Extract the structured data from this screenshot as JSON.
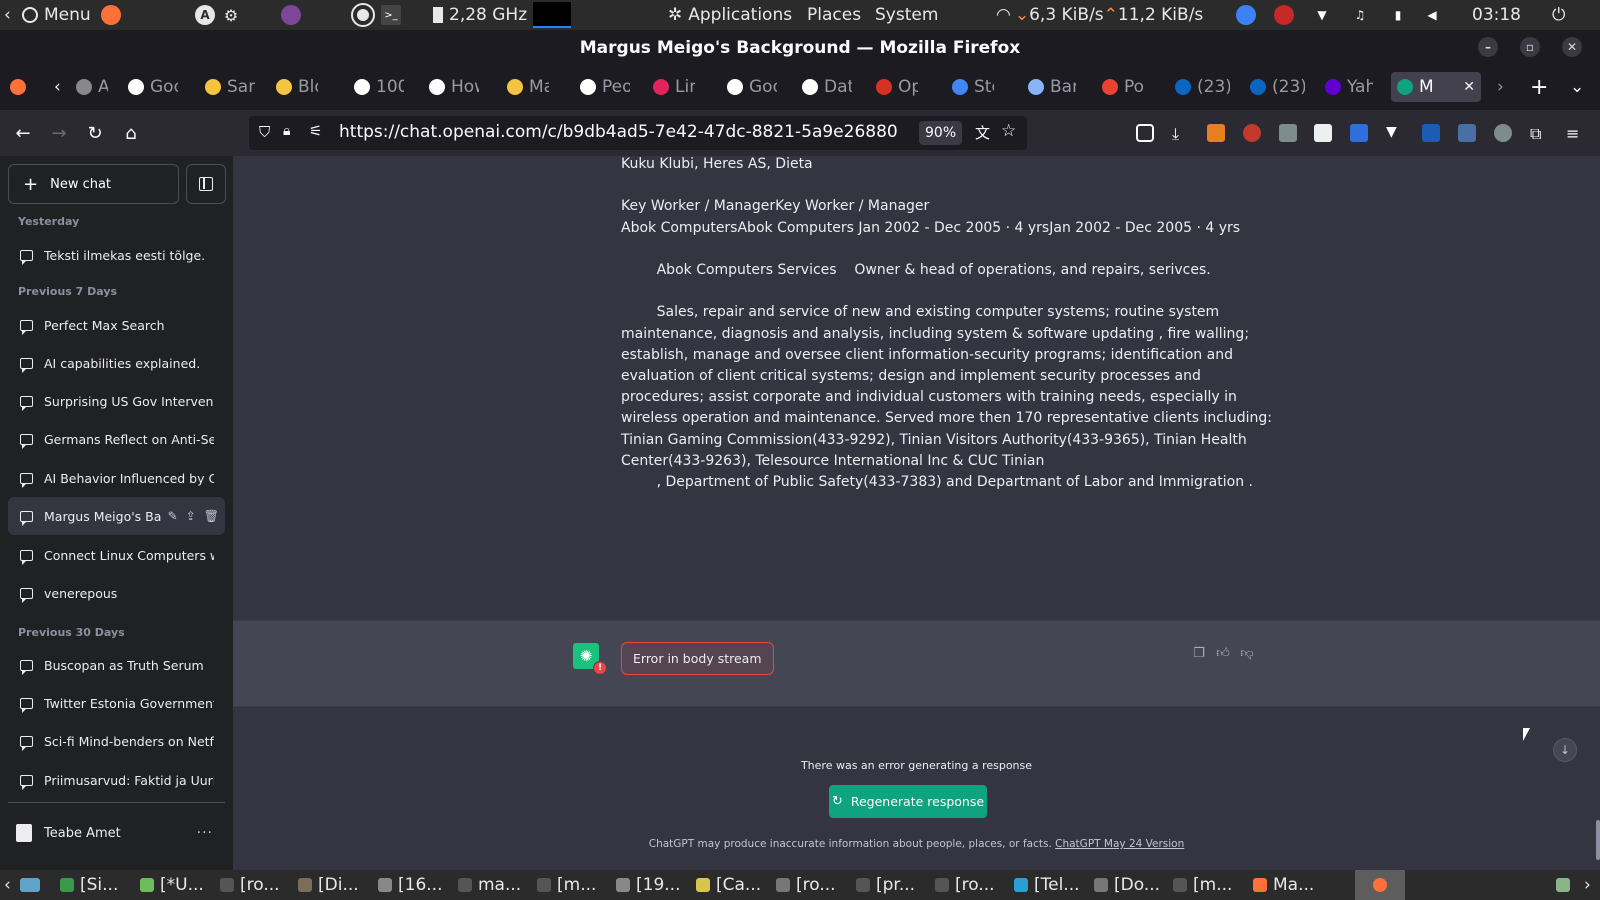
{
  "os_panel": {
    "menu": "Menu",
    "cpu": "2,28 GHz",
    "applications": "Applications",
    "places": "Places",
    "system": "System",
    "net_down": "6,3 KiB/s",
    "net_up": "11,2 KiB/s",
    "clock": "03:18"
  },
  "window": {
    "title": "Margus Meigo's Background — Mozilla Firefox"
  },
  "tabs": [
    {
      "label": "App",
      "color": "#888888"
    },
    {
      "label": "Goo",
      "color": "#ffffff"
    },
    {
      "label": "Sam",
      "color": "#f5c542"
    },
    {
      "label": "Blo",
      "color": "#f5c542"
    },
    {
      "label": "100",
      "color": "#ffffff"
    },
    {
      "label": "How",
      "color": "#ffffff"
    },
    {
      "label": "Mac",
      "color": "#f5c542"
    },
    {
      "label": "Peo",
      "color": "#ffffff"
    },
    {
      "label": "Linu",
      "color": "#e0245e"
    },
    {
      "label": "Goo",
      "color": "#ffffff"
    },
    {
      "label": "Dat",
      "color": "#ffffff"
    },
    {
      "label": "Ope",
      "color": "#d93025"
    },
    {
      "label": "Ste",
      "color": "#4285f4"
    },
    {
      "label": "Bar",
      "color": "#8ab4f8"
    },
    {
      "label": "Pos",
      "color": "#ea4335"
    },
    {
      "label": "(23)",
      "color": "#0a66c2"
    },
    {
      "label": "(23)",
      "color": "#0a66c2"
    },
    {
      "label": "Yah",
      "color": "#6001d2"
    },
    {
      "label": "M",
      "color": "#10a37f"
    }
  ],
  "navbar": {
    "url": "https://chat.openai.com/c/b9db4ad5-7e42-47dc-8821-5a9e26880",
    "zoom": "90%"
  },
  "sidebar": {
    "new_chat": "New chat",
    "sections": [
      {
        "label": "Yesterday",
        "items": [
          "Teksti ilmekas eesti tõlge."
        ]
      },
      {
        "label": "Previous 7 Days",
        "items": [
          "Perfect Max Search",
          "AI capabilities explained.",
          "Surprising US Gov Intervention",
          "Germans Reflect on Anti-Semiti",
          "AI Behavior Influenced by Chat",
          "Margus Meigo's Back",
          "Connect Linux Computers with",
          "venerepous"
        ]
      },
      {
        "label": "Previous 30 Days",
        "items": [
          "Buscopan as Truth Serum",
          "Twitter Estonia Government Ac",
          "Sci-fi Mind-benders on Netflix",
          "Priimusarvud: Faktid ja Uurimus"
        ]
      }
    ],
    "user": "Teabe Amet"
  },
  "conversation": {
    "lines": [
      "Kuku Klubi, Heres AS, Dieta",
      "",
      "Key Worker / ManagerKey Worker / Manager",
      "Abok ComputersAbok Computers Jan 2002 - Dec 2005 · 4 yrsJan 2002 - Dec 2005 · 4 yrs",
      "",
      "        Abok Computers Services    Owner & head of operations, and repairs, serivces.",
      "",
      "        Sales, repair and service of new and existing computer systems; routine system",
      "maintenance, diagnosis and analysis, including system & software updating , fire walling;",
      "establish, manage and oversee client information-security programs; identification and",
      "evaluation of client critical systems; design and implement security processes and",
      "procedures; assist corporate and individual customers with training needs, especially in",
      "wireless operation and maintenance. Served more then 170 representative clients including:",
      "Tinian Gaming Commission(433-9292), Tinian Visitors Authority(433-9365), Tinian Health",
      "Center(433-9263), Telesource International Inc & CUC Tinian",
      "        , Department of Public Safety(433-7383) and Departmant of Labor and Immigration ."
    ],
    "error_message": "Error in body stream",
    "error_badge": "!",
    "error_note": "There was an error generating a response",
    "regenerate": "Regenerate response",
    "disclaimer_text": "ChatGPT may produce inaccurate information about people, places, or facts.",
    "disclaimer_link": "ChatGPT May 24 Version"
  },
  "taskbar": [
    {
      "label": "[Si...",
      "color": "#3a9a4a"
    },
    {
      "label": "[*U...",
      "color": "#6bbf59"
    },
    {
      "label": "[ro...",
      "color": "#555555"
    },
    {
      "label": "[Di...",
      "color": "#7a6e5a"
    },
    {
      "label": "[16...",
      "color": "#888888"
    },
    {
      "label": "ma...",
      "color": "#555555"
    },
    {
      "label": "[m...",
      "color": "#555555"
    },
    {
      "label": "[19...",
      "color": "#888888"
    },
    {
      "label": "[Ca...",
      "color": "#d8c64a"
    },
    {
      "label": "[ro...",
      "color": "#777777"
    },
    {
      "label": "[pr...",
      "color": "#555555"
    },
    {
      "label": "[ro...",
      "color": "#555555"
    },
    {
      "label": "[Tel...",
      "color": "#2a9fd6"
    },
    {
      "label": "[Do...",
      "color": "#777777"
    },
    {
      "label": "[m...",
      "color": "#555555"
    },
    {
      "label": "Ma...",
      "color": "#ff7139"
    }
  ],
  "colors": {
    "accent": "#10a37f",
    "error": "#ef4146",
    "sidebar_bg": "#202123",
    "main_bg": "#343541"
  }
}
